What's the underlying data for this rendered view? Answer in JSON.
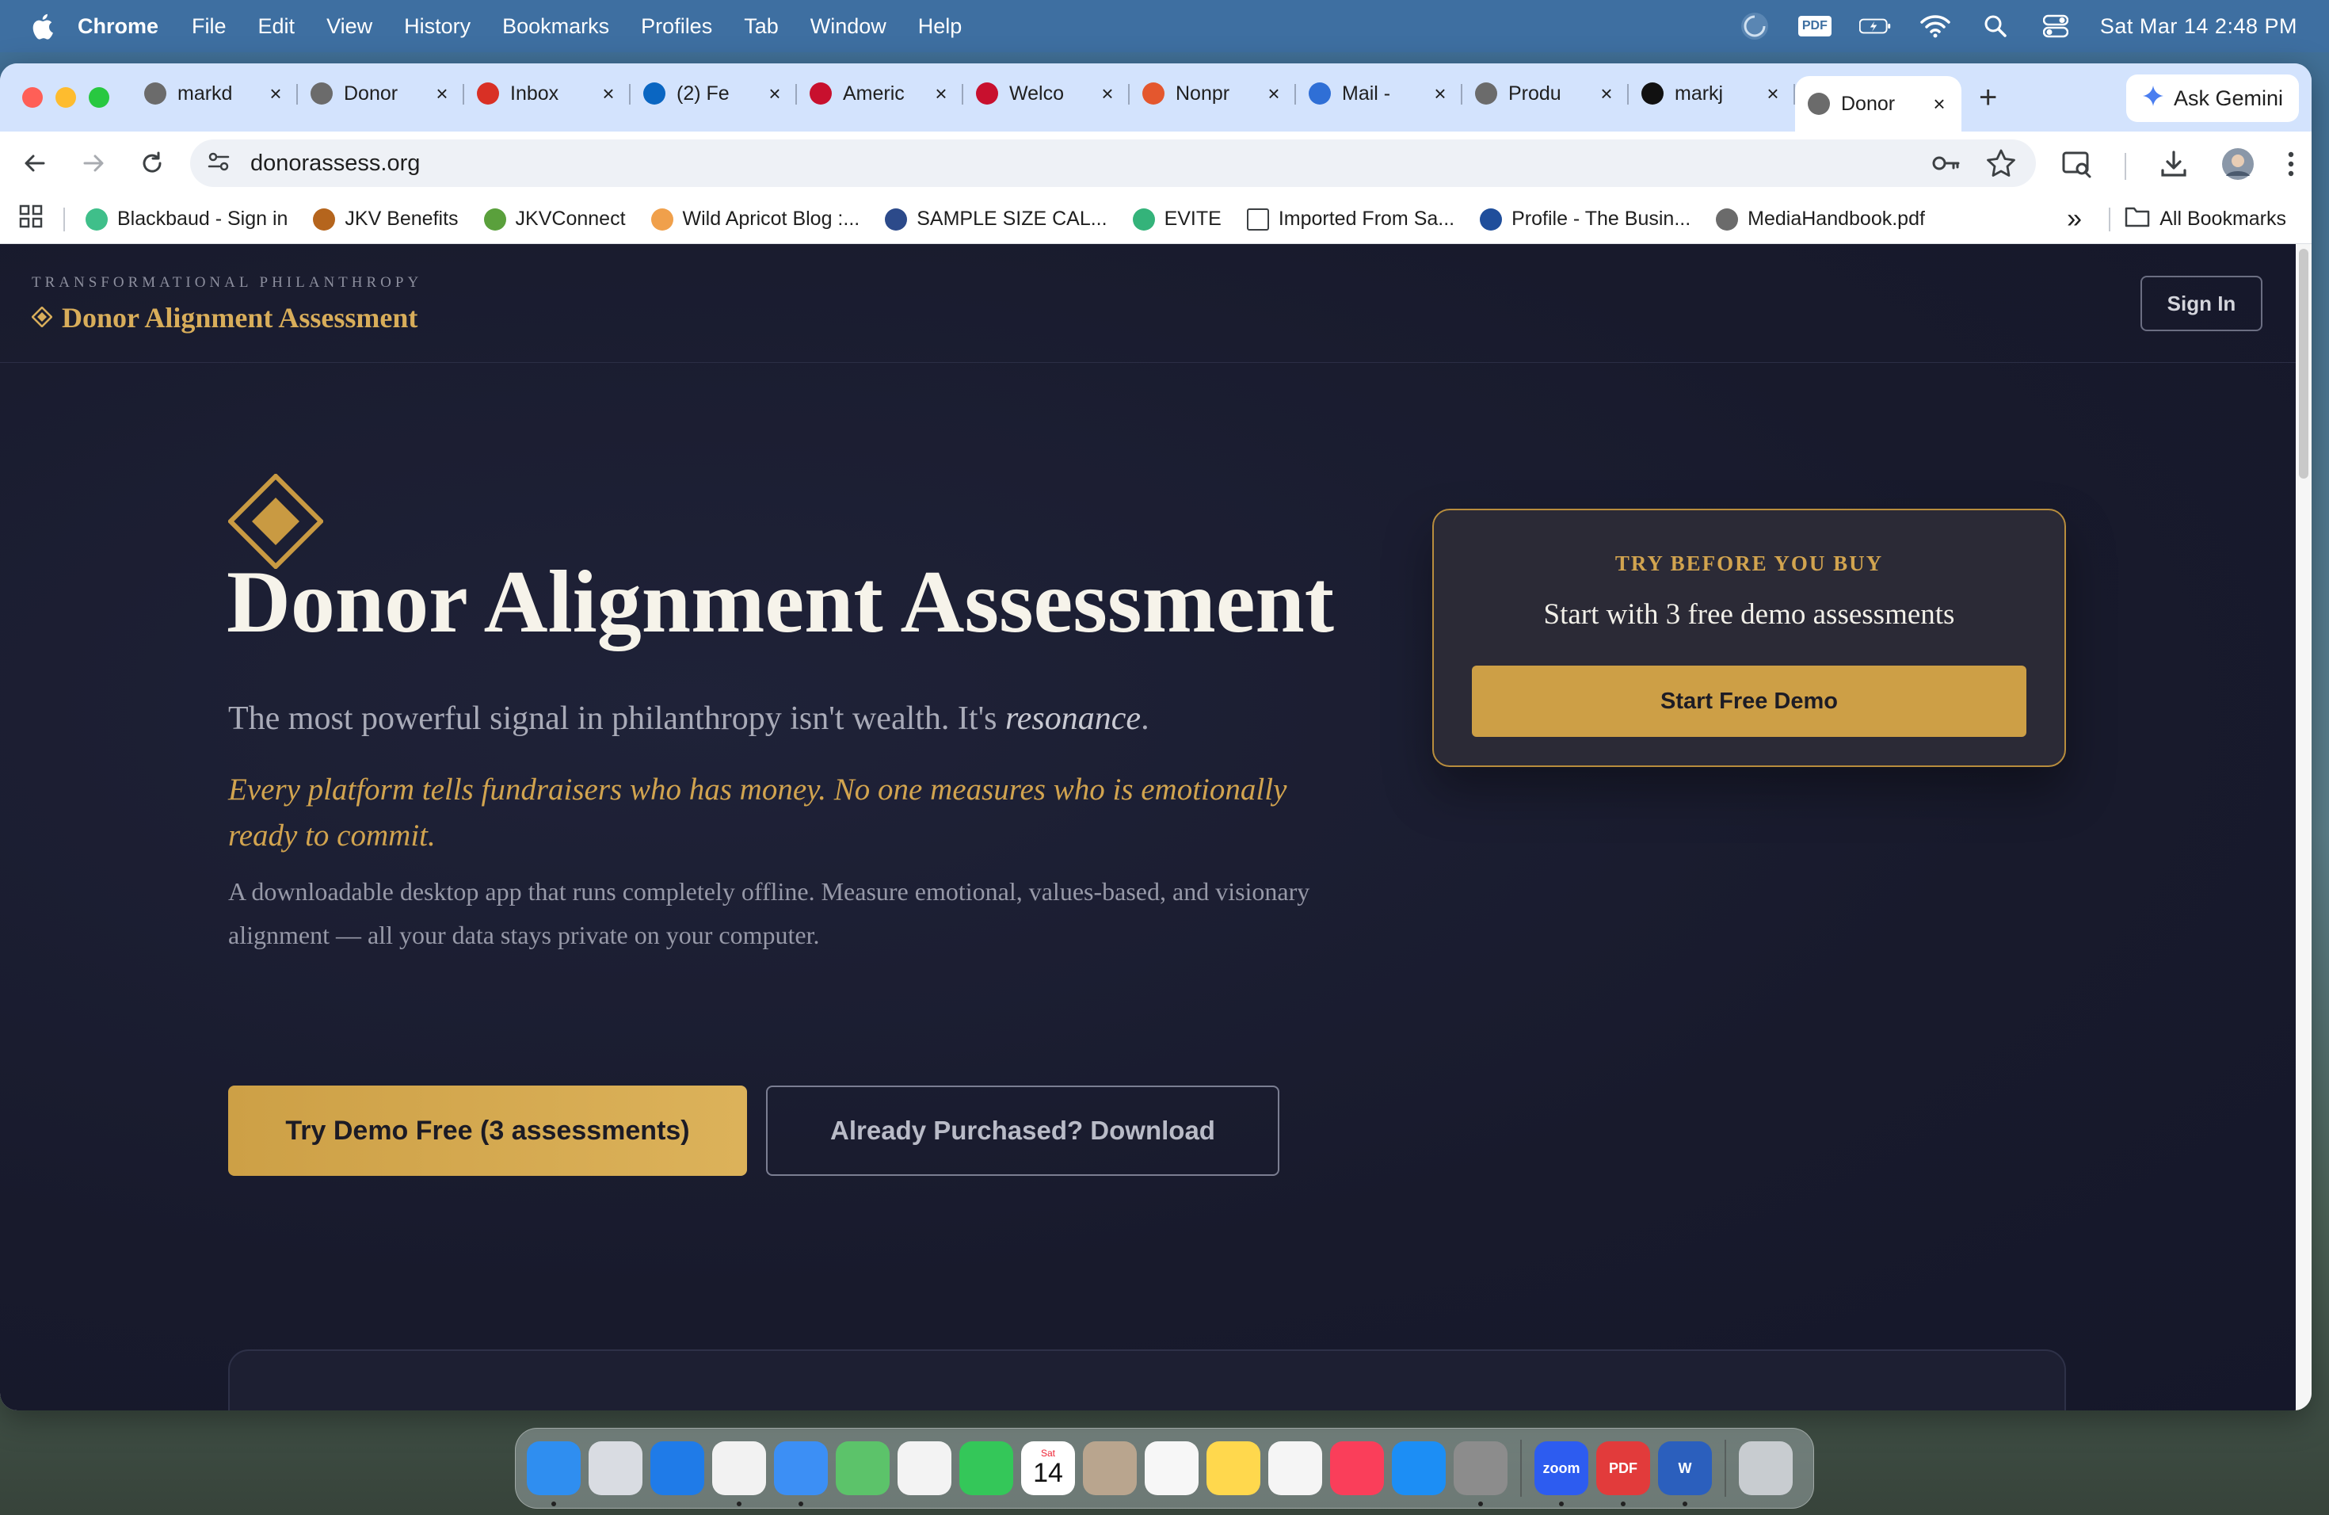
{
  "menubar": {
    "app": "Chrome",
    "items": [
      "File",
      "Edit",
      "View",
      "History",
      "Bookmarks",
      "Profiles",
      "Tab",
      "Window",
      "Help"
    ],
    "pdf_badge": "PDF",
    "clock": "Sat Mar 14  2:48 PM"
  },
  "tabs": [
    {
      "title": "markd",
      "color": "#6b6b6b"
    },
    {
      "title": "Donor",
      "color": "#6b6b6b"
    },
    {
      "title": "Inbox",
      "color": "#d93025"
    },
    {
      "title": "(2) Fe",
      "color": "#0a66c2"
    },
    {
      "title": "Americ",
      "color": "#c8102e"
    },
    {
      "title": "Welco",
      "color": "#c8102e"
    },
    {
      "title": "Nonpr",
      "color": "#e4572e"
    },
    {
      "title": "Mail -",
      "color": "#2f6fd6"
    },
    {
      "title": "Produ",
      "color": "#6b6b6b"
    },
    {
      "title": "markj",
      "color": "#111111"
    },
    {
      "title": "Donor",
      "color": "#6b6b6b",
      "active": true
    }
  ],
  "gemini_label": "Ask Gemini",
  "address": {
    "url": "donorassess.org"
  },
  "bookmarks": [
    {
      "label": "Blackbaud - Sign in",
      "color": "#3fbf8a"
    },
    {
      "label": "JKV Benefits",
      "color": "#b5651d"
    },
    {
      "label": "JKVConnect",
      "color": "#5aa03c"
    },
    {
      "label": "Wild Apricot Blog :...",
      "color": "#f0a04b"
    },
    {
      "label": "SAMPLE SIZE CAL...",
      "color": "#2c4a8a"
    },
    {
      "label": "EVITE",
      "color": "#34b37a"
    },
    {
      "label": "Imported From Sa...",
      "color": "#ffffff"
    },
    {
      "label": "Profile - The Busin...",
      "color": "#1f4e9b"
    },
    {
      "label": "MediaHandbook.pdf",
      "color": "#6b6b6b"
    }
  ],
  "bookmarks_more": "»",
  "all_bookmarks": "All Bookmarks",
  "site": {
    "kicker": "TRANSFORMATIONAL PHILANTHROPY",
    "brand": "Donor Alignment Assessment",
    "signin": "Sign In",
    "hero_title": "Donor Alignment Assessment",
    "subtitle_plain": "The most powerful signal in philanthropy isn't wealth. It's ",
    "subtitle_em": "resonance",
    "subtitle_end": ".",
    "tagline": "Every platform tells fundraisers who has money. No one measures who is emotionally ready to commit.",
    "desc": "A downloadable desktop app that runs completely offline. Measure emotional, values-based, and visionary alignment — all your data stays private on your computer.",
    "cta_primary": "Try Demo Free (3 assessments)",
    "cta_secondary": "Already Purchased? Download",
    "demo": {
      "kicker": "TRY BEFORE YOU BUY",
      "text": "Start with 3 free demo assessments",
      "button": "Start Free Demo"
    },
    "quote_mark": "“"
  },
  "colors": {
    "gold": "#d2a44f",
    "navy": "#181a2c",
    "cream": "#f6f3ea"
  },
  "dock": {
    "apps": [
      {
        "name": "finder",
        "color": "#2f8ef0",
        "running": true
      },
      {
        "name": "launchpad",
        "color": "#d9dce2"
      },
      {
        "name": "safari",
        "color": "#1f7be8"
      },
      {
        "name": "chrome",
        "color": "#f2f2f2",
        "running": true
      },
      {
        "name": "mail",
        "color": "#3c8ff5",
        "running": true
      },
      {
        "name": "maps",
        "color": "#5cc36a"
      },
      {
        "name": "photos",
        "color": "#f3f3f3"
      },
      {
        "name": "facetime",
        "color": "#34c759"
      },
      {
        "name": "calendar",
        "color": "#ffffff"
      },
      {
        "name": "contacts",
        "color": "#b9a58e"
      },
      {
        "name": "reminders",
        "color": "#f7f7f7"
      },
      {
        "name": "notes",
        "color": "#ffd84d"
      },
      {
        "name": "freeform",
        "color": "#f5f5f5"
      },
      {
        "name": "music",
        "color": "#fa3e5a"
      },
      {
        "name": "app-store",
        "color": "#1c8ef5"
      },
      {
        "name": "system-settings",
        "color": "#8c8c8c",
        "running": true
      }
    ],
    "calendar_day": "14",
    "calendar_month": "Sat",
    "zoom_label": "zoom",
    "pdf_label": "PDF",
    "word_label": "W"
  }
}
